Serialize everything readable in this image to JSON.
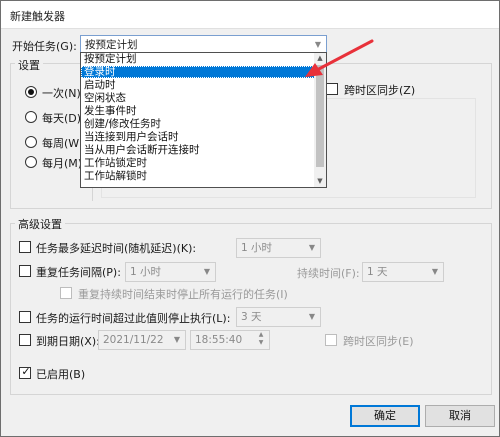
{
  "window": {
    "title": "新建触发器"
  },
  "begin_task": {
    "label": "开始任务(G):",
    "value": "按预定计划",
    "options": [
      "按预定计划",
      "登录时",
      "启动时",
      "空闲状态",
      "发生事件时",
      "创建/修改任务时",
      "当连接到用户会话时",
      "当从用户会话断开连接时",
      "工作站锁定时",
      "工作站解锁时"
    ],
    "selected_index": 1
  },
  "settings": {
    "title": "设置",
    "radios": [
      {
        "label": "一次(N)",
        "checked": true
      },
      {
        "label": "每天(D)",
        "checked": false
      },
      {
        "label": "每周(W)",
        "checked": false
      },
      {
        "label": "每月(M)",
        "checked": false
      }
    ],
    "sync_tz": {
      "label": "跨时区同步(Z)",
      "checked": false
    }
  },
  "advanced": {
    "title": "高级设置",
    "delay": {
      "label": "任务最多延迟时间(随机延迟)(K):",
      "checked": false,
      "value": "1 小时"
    },
    "repeat": {
      "label": "重复任务间隔(P):",
      "checked": false,
      "value": "1 小时",
      "duration_label": "持续时间(F):",
      "duration_value": "1 天"
    },
    "stop_running": {
      "label": "重复持续时间结束时停止所有运行的任务(I)",
      "checked": false
    },
    "stop_if_longer": {
      "label": "任务的运行时间超过此值则停止执行(L):",
      "checked": false,
      "value": "3 天"
    },
    "expire": {
      "label": "到期日期(X):",
      "checked": false,
      "date": "2021/11/22",
      "time": "18:55:40",
      "sync_label": "跨时区同步(E)"
    },
    "enabled": {
      "label": "已启用(B)",
      "checked": true
    }
  },
  "buttons": {
    "ok": "确定",
    "cancel": "取消"
  },
  "colors": {
    "selection": "#0078d7",
    "annotation_arrow": "#e8313a"
  }
}
